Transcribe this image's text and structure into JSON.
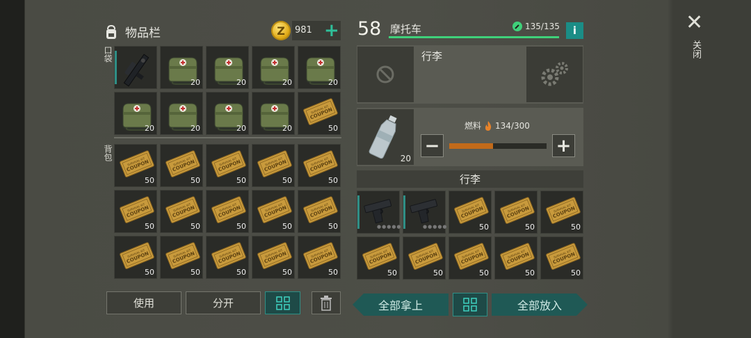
{
  "inventory": {
    "title": "物品栏",
    "coins": "981",
    "pocket_label": "口袋",
    "backpack_label": "背包",
    "pocket_slots": [
      {
        "item": "scope-rifle",
        "count": ""
      },
      {
        "item": "med-bag",
        "count": "20"
      },
      {
        "item": "med-bag",
        "count": "20"
      },
      {
        "item": "med-bag",
        "count": "20"
      },
      {
        "item": "med-bag",
        "count": "20"
      },
      {
        "item": "med-bag",
        "count": "20"
      },
      {
        "item": "med-bag",
        "count": "20"
      },
      {
        "item": "med-bag",
        "count": "20"
      },
      {
        "item": "med-bag",
        "count": "20"
      },
      {
        "item": "coupon",
        "count": "50"
      }
    ],
    "backpack_slots_count": "50",
    "buttons": {
      "use": "使用",
      "split": "分开"
    }
  },
  "vehicle": {
    "level": "58",
    "name": "摩托车",
    "hp": "135/135",
    "hp_fraction": 1.0,
    "info": "i",
    "slot_title": "行李",
    "fuel_label": "燃料",
    "fuel_value": "134/300",
    "fuel_fraction": 0.45,
    "fuel_item_count": "20",
    "trunk_title": "行李",
    "trunk_slots": [
      {
        "item": "pistol",
        "count": ""
      },
      {
        "item": "pistol",
        "count": ""
      },
      {
        "item": "coupon",
        "count": "50"
      },
      {
        "item": "coupon",
        "count": "50"
      },
      {
        "item": "coupon",
        "count": "50"
      },
      {
        "item": "coupon",
        "count": "50"
      },
      {
        "item": "coupon",
        "count": "50"
      },
      {
        "item": "coupon",
        "count": "50"
      },
      {
        "item": "coupon",
        "count": "50"
      },
      {
        "item": "coupon",
        "count": "50"
      }
    ],
    "buttons": {
      "take_all": "全部拿上",
      "put_all": "全部放入"
    }
  },
  "close_label": "关闭",
  "colors": {
    "accent_teal": "#2f8f86",
    "hp_green": "#3fd17a",
    "fuel_orange": "#c26a1a"
  }
}
